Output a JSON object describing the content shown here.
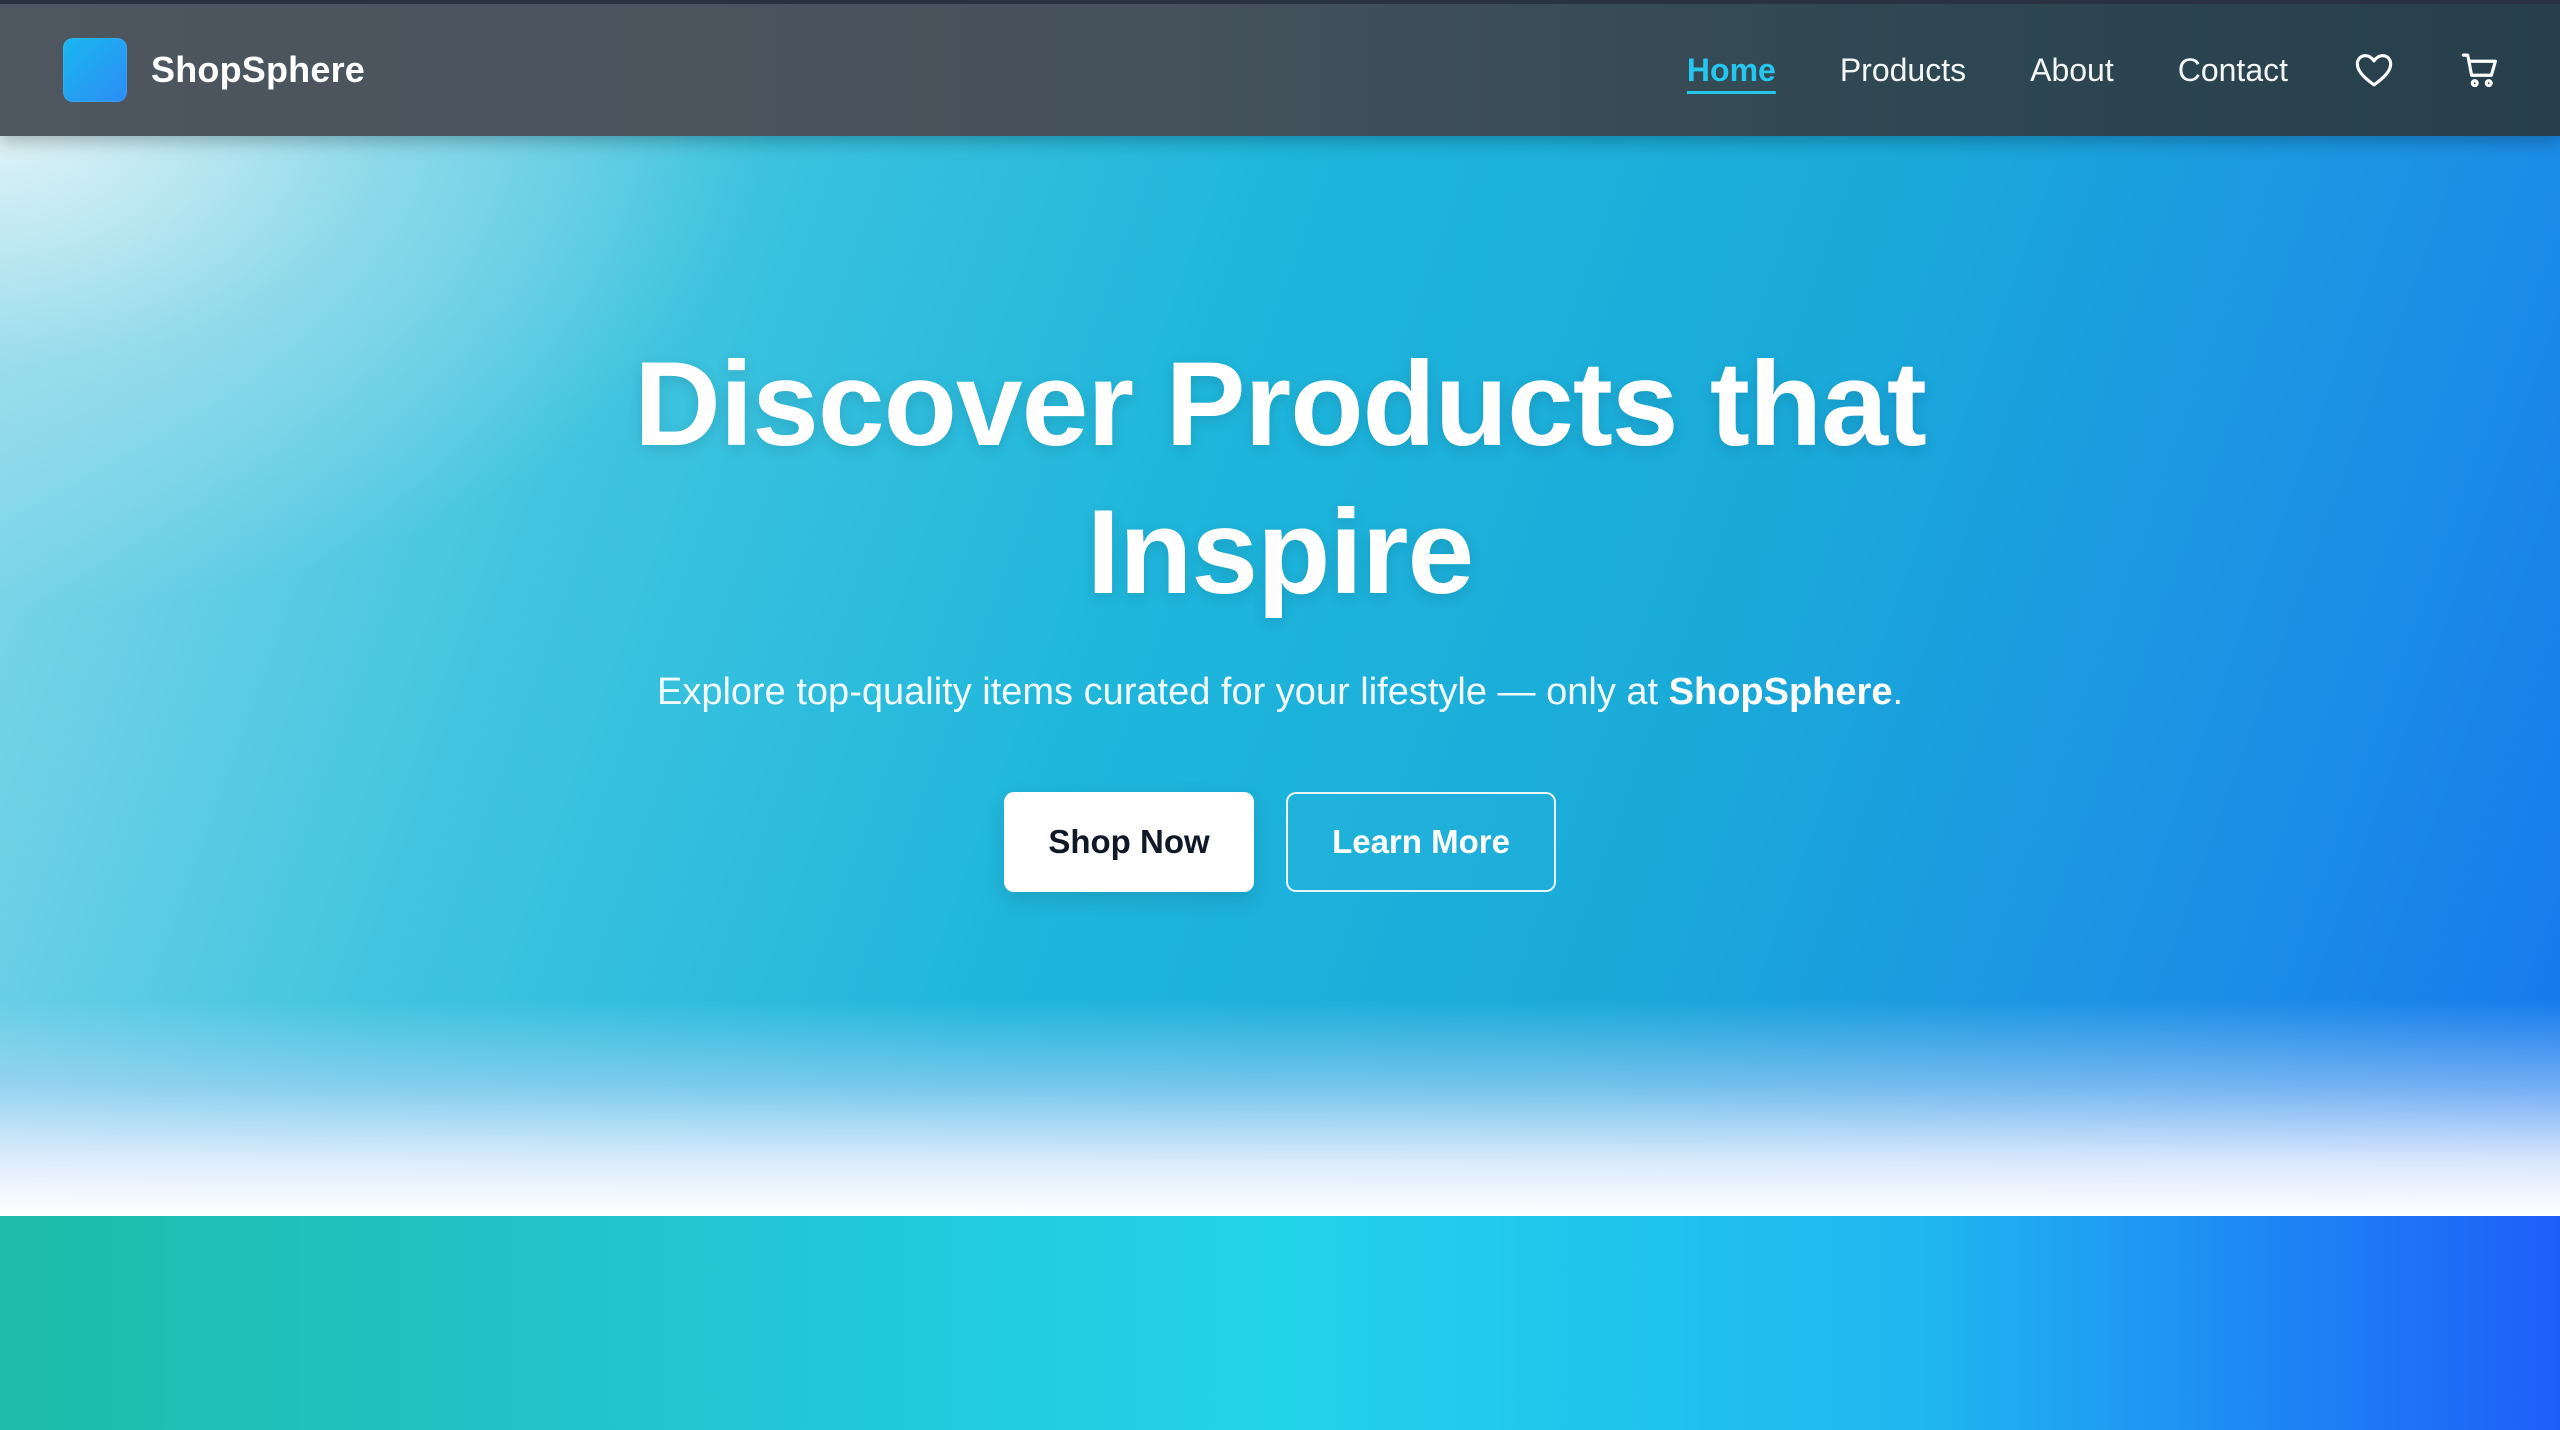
{
  "brand": {
    "name": "ShopSphere",
    "logo_color": "#1fa6f3"
  },
  "nav": {
    "links": [
      {
        "label": "Home",
        "active": true
      },
      {
        "label": "Products",
        "active": false
      },
      {
        "label": "About",
        "active": false
      },
      {
        "label": "Contact",
        "active": false
      }
    ],
    "icons": [
      "heart-icon",
      "cart-icon"
    ],
    "active_color": "#27c6ef"
  },
  "hero": {
    "title": "Discover Products that Inspire",
    "subtitle_prefix": "Explore top-quality items curated for your lifestyle — only at ",
    "subtitle_brand": "ShopSphere",
    "subtitle_suffix": ".",
    "primary_cta": "Shop Now",
    "secondary_cta": "Learn More",
    "gradient_colors": [
      "#8fdaec",
      "#1fb6dc",
      "#1577ee"
    ]
  },
  "bottom_band": {
    "gradient_colors": [
      "#1fbca9",
      "#23d3ea",
      "#1e5ef8"
    ]
  }
}
